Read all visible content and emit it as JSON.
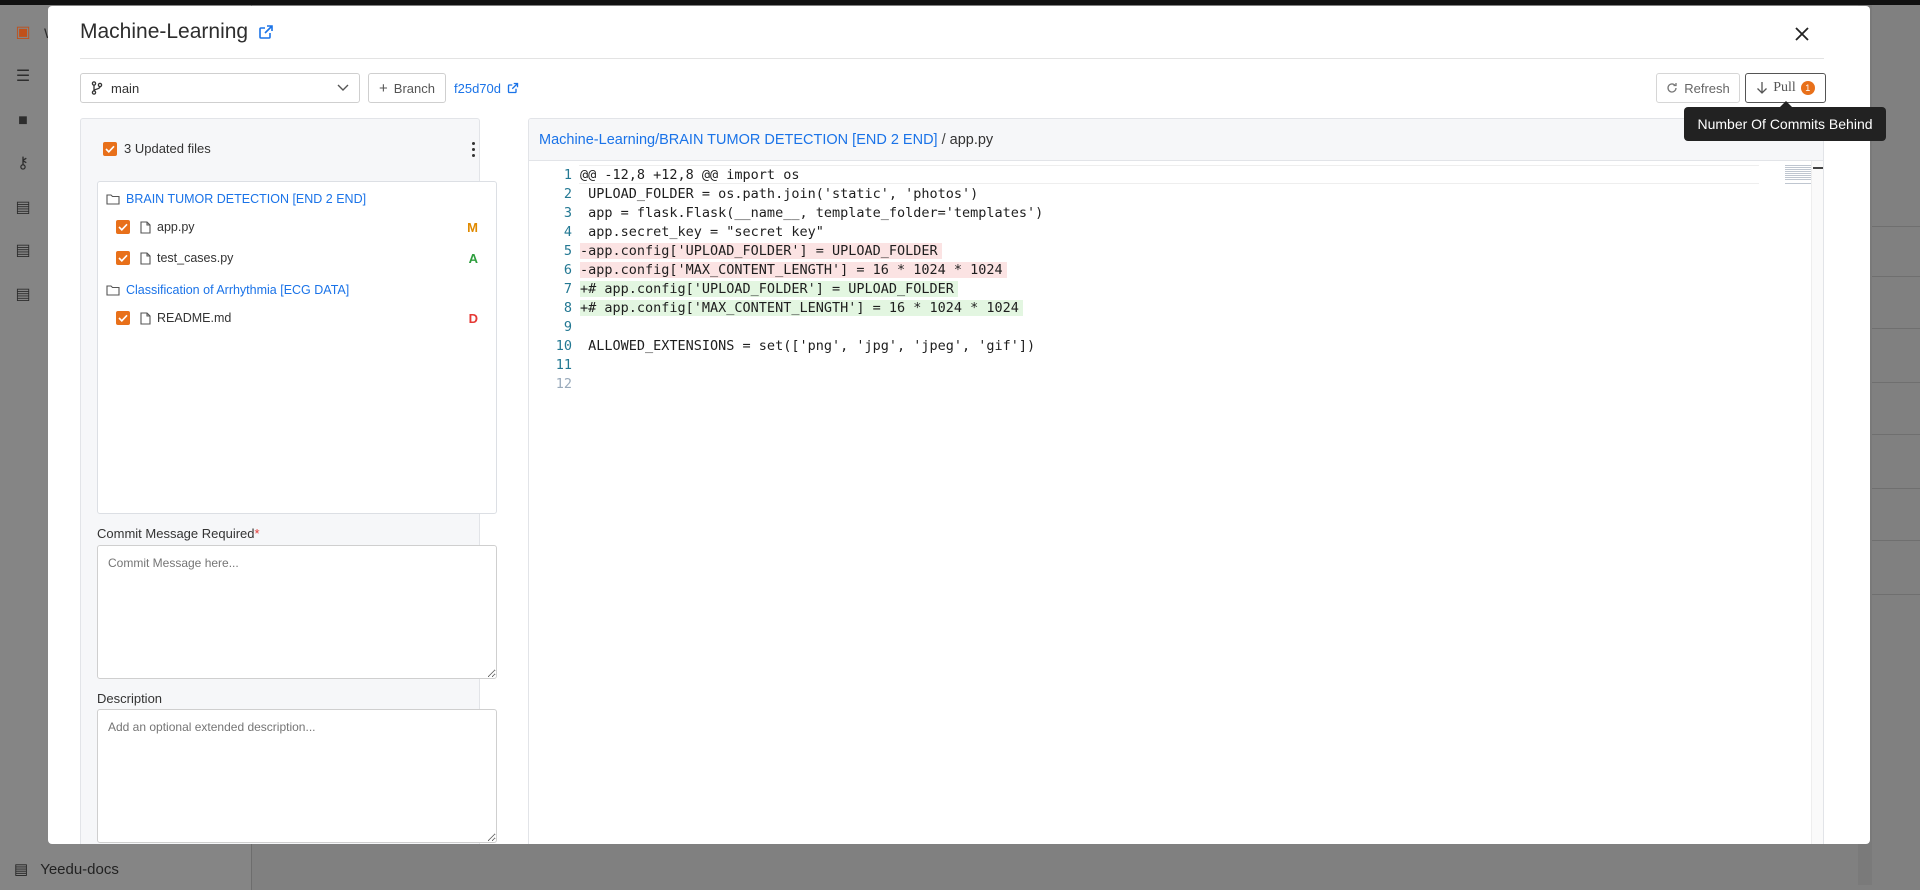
{
  "background": {
    "sidebar_footer_label": "Yeedu-docs",
    "sidebar_partial_labels": [
      "W",
      "",
      "",
      "",
      "",
      "",
      ""
    ]
  },
  "modal": {
    "title": "Machine-Learning",
    "branch": {
      "selected": "main",
      "new_branch_label": "Branch",
      "commit_hash": "f25d70d"
    },
    "actions": {
      "refresh_label": "Refresh",
      "pull_label": "Pull",
      "pull_badge": "1"
    },
    "tooltip": "Number Of Commits Behind",
    "files": {
      "header": "3 Updated files",
      "groups": [
        {
          "folder": "BRAIN TUMOR DETECTION [END 2 END]",
          "files": [
            {
              "name": "app.py",
              "status": "M",
              "status_color": "#e08a00"
            },
            {
              "name": "test_cases.py",
              "status": "A",
              "status_color": "#2e9e3e"
            }
          ]
        },
        {
          "folder": "Classification of Arrhythmia [ECG DATA]",
          "files": [
            {
              "name": "README.md",
              "status": "D",
              "status_color": "#e53935"
            }
          ]
        }
      ]
    },
    "commit_message": {
      "label": "Commit Message Required",
      "required_mark": "*",
      "placeholder": "Commit Message here..."
    },
    "description": {
      "label": "Description",
      "placeholder": "Add an optional extended description..."
    },
    "diff": {
      "path": "Machine-Learning/BRAIN TUMOR DETECTION [END 2 END]",
      "separator": "/",
      "filename": "app.py",
      "lines": [
        {
          "n": "1",
          "text": "@@ -12,8 +12,8 @@ import os",
          "kind": "ctx"
        },
        {
          "n": "2",
          "text": " UPLOAD_FOLDER = os.path.join('static', 'photos')",
          "kind": "ctx"
        },
        {
          "n": "3",
          "text": " app = flask.Flask(__name__, template_folder='templates')",
          "kind": "ctx"
        },
        {
          "n": "4",
          "text": " app.secret_key = \"secret key\"",
          "kind": "ctx"
        },
        {
          "n": "5",
          "text": "-app.config['UPLOAD_FOLDER'] = UPLOAD_FOLDER",
          "kind": "del"
        },
        {
          "n": "6",
          "text": "-app.config['MAX_CONTENT_LENGTH'] = 16 * 1024 * 1024",
          "kind": "del"
        },
        {
          "n": "7",
          "text": "+# app.config['UPLOAD_FOLDER'] = UPLOAD_FOLDER",
          "kind": "add"
        },
        {
          "n": "8",
          "text": "+# app.config['MAX_CONTENT_LENGTH'] = 16 * 1024 * 1024",
          "kind": "add"
        },
        {
          "n": "9",
          "text": "",
          "kind": "ctx"
        },
        {
          "n": "10",
          "text": " ALLOWED_EXTENSIONS = set(['png', 'jpg', 'jpeg', 'gif'])",
          "kind": "ctx"
        },
        {
          "n": "11",
          "text": "",
          "kind": "ctx"
        },
        {
          "n": "12",
          "text": "",
          "kind": "dim"
        }
      ]
    }
  }
}
